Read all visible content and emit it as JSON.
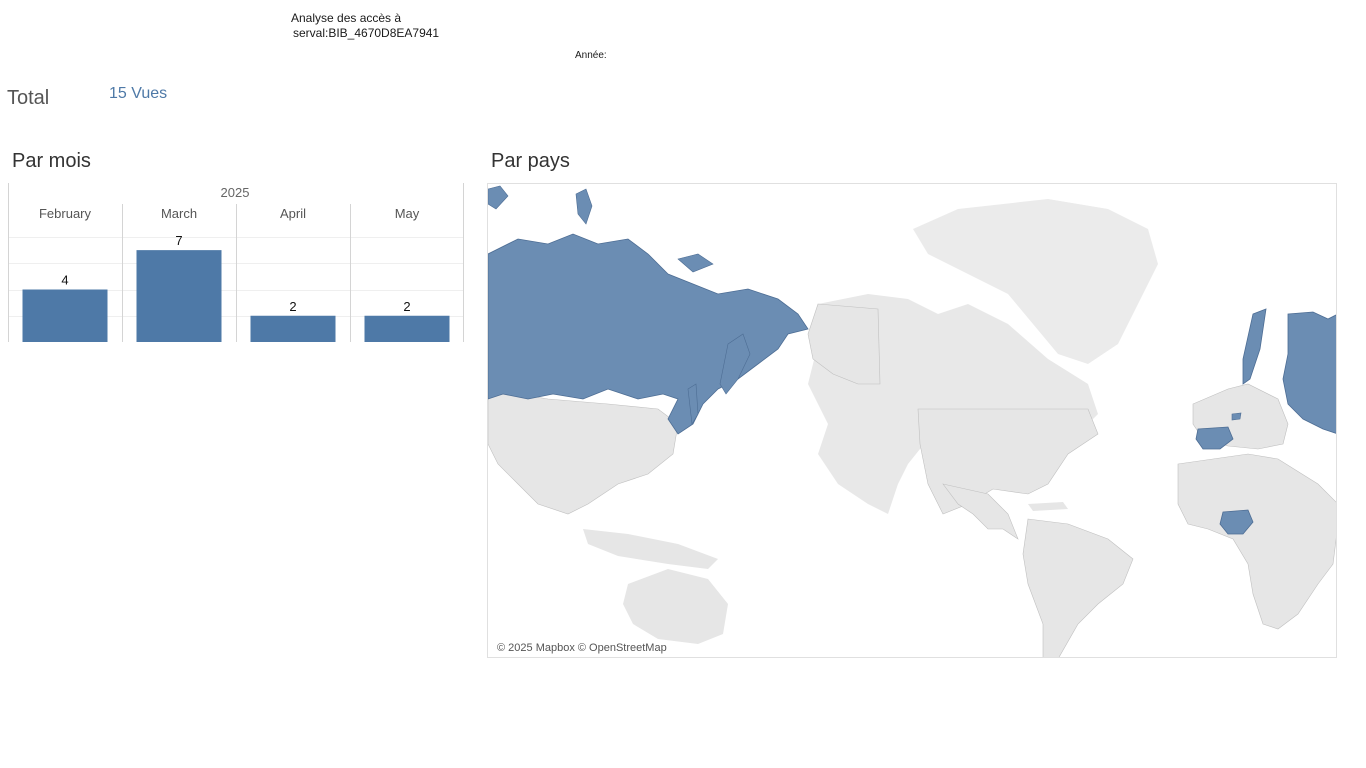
{
  "header": {
    "title_line1": "Analyse des accès à",
    "title_line2": "serval:BIB_4670D8EA7941",
    "year_filter_label": "Année:"
  },
  "summary": {
    "total_label": "Total",
    "total_value": "15 Vues"
  },
  "sections": {
    "by_month": "Par mois",
    "by_country": "Par pays"
  },
  "chart_data": {
    "type": "bar",
    "group_label": "2025",
    "categories": [
      "February",
      "March",
      "April",
      "May"
    ],
    "values": [
      4,
      7,
      2,
      2
    ],
    "ylim": [
      0,
      8
    ],
    "grid": true,
    "bar_color": "#4e79a7"
  },
  "map": {
    "attribution": "© 2025 Mapbox © OpenStreetMap",
    "highlight_color": "#6b8db3",
    "land_color": "#e6e6e6"
  }
}
